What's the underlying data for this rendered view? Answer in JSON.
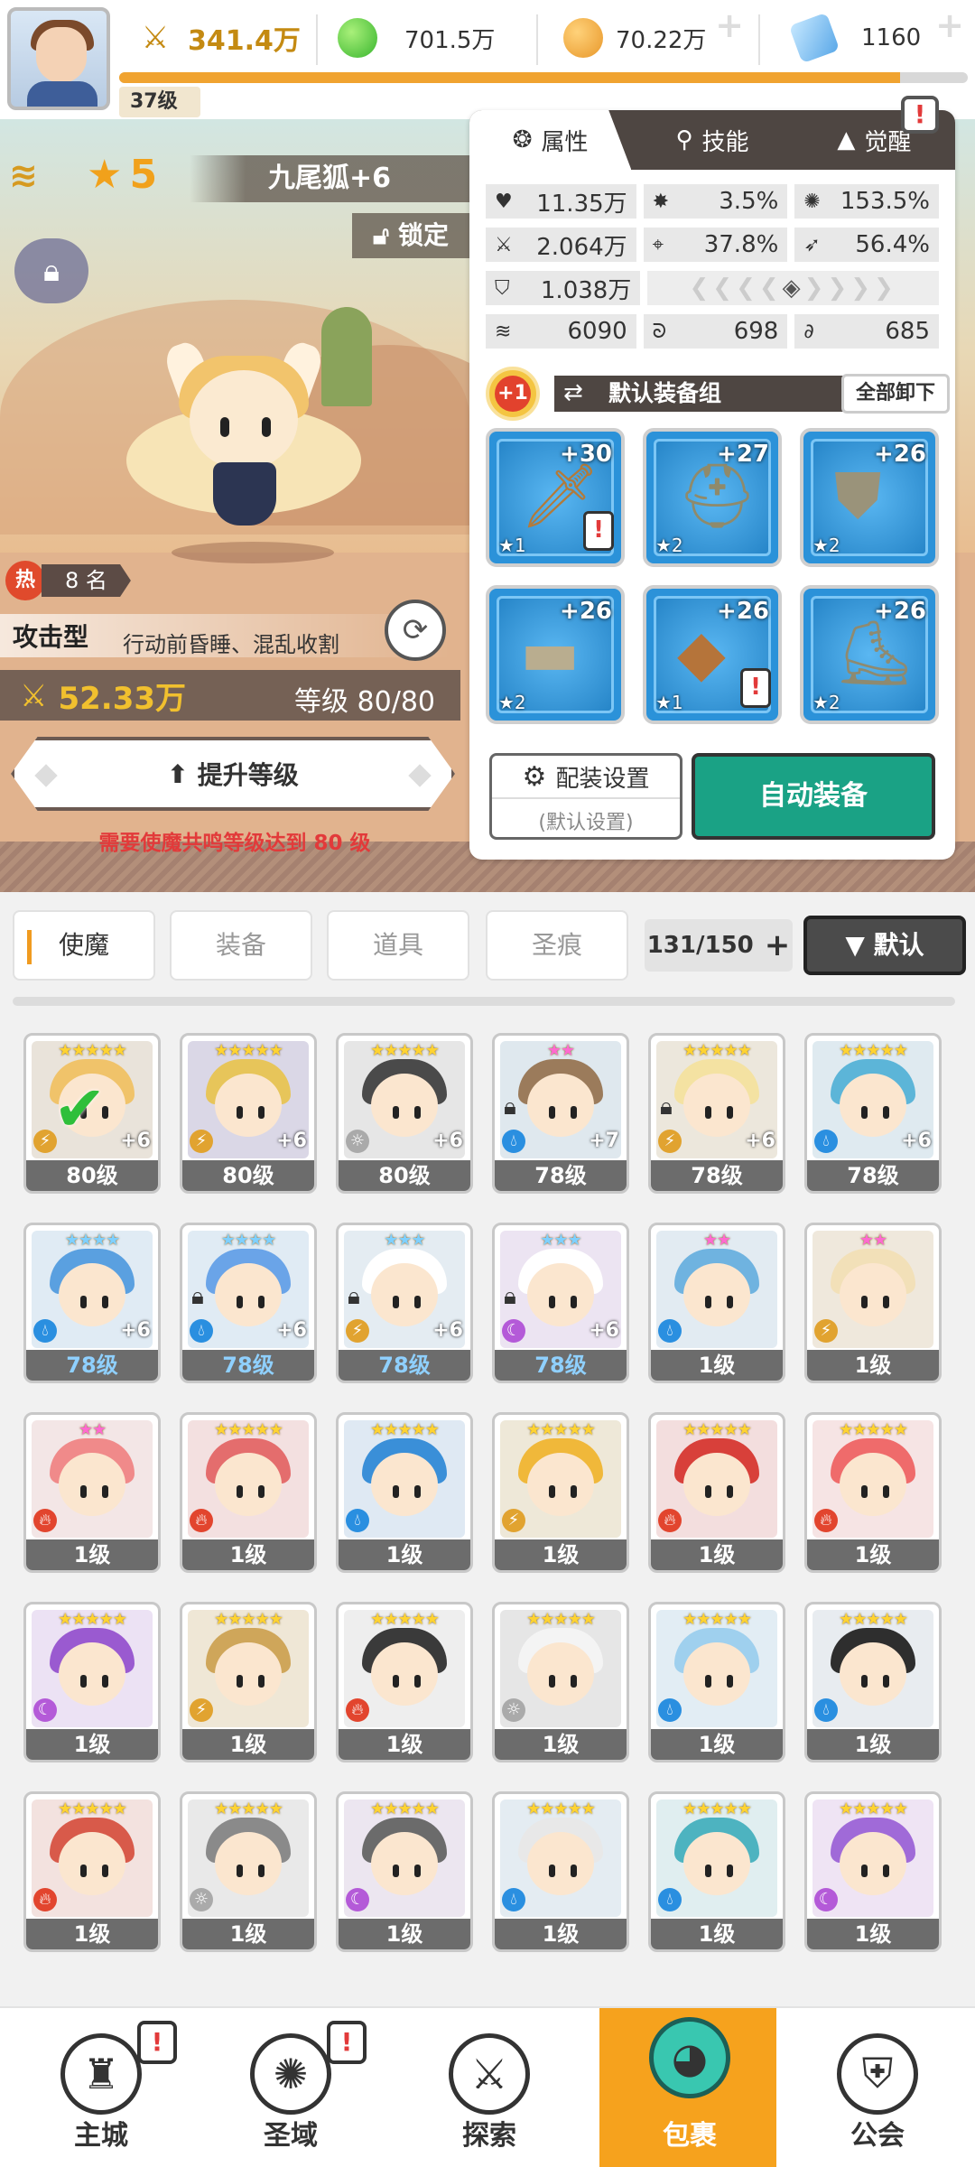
{
  "top": {
    "player_level": "37级",
    "xp_progress": 0.92,
    "power": "341.4万",
    "green_currency": "701.5万",
    "gold_currency": "70.22万",
    "gem_currency": "1160"
  },
  "hero": {
    "stars": "5",
    "name": "九尾狐+6",
    "lock_label": "锁定",
    "hot_label": "热",
    "rank_label": "8 名",
    "type": "攻击型",
    "type_desc": "行动前昏睡、混乱收割",
    "power": "52.33万",
    "level": "等级 80/80",
    "upgrade_label": "提升等级",
    "requirement": "需要使魔共鸣等级达到 80 级"
  },
  "panel": {
    "tabs": [
      {
        "label": "属性",
        "icon": "attributes-icon"
      },
      {
        "label": "技能",
        "icon": "skills-icon"
      },
      {
        "label": "觉醒",
        "icon": "awaken-icon"
      }
    ],
    "stats": {
      "hp": "11.35万",
      "crit_rate": "3.5%",
      "crit_dmg": "153.5%",
      "attack": "2.064万",
      "accuracy": "37.8%",
      "dodge": "56.4%",
      "defense": "1.038万",
      "speed": "6090",
      "effect_hit": "698",
      "effect_res": "685"
    },
    "medal": "+1",
    "equip_set": "默认装备组",
    "unequip_all": "全部卸下",
    "equipment": [
      {
        "name": "sword",
        "plus": "+30",
        "stars": "★1",
        "warn": true
      },
      {
        "name": "helmet",
        "plus": "+27",
        "stars": "★2",
        "warn": false
      },
      {
        "name": "armor",
        "plus": "+26",
        "stars": "★2",
        "warn": false
      },
      {
        "name": "belt",
        "plus": "+26",
        "stars": "★2",
        "warn": false
      },
      {
        "name": "necklace",
        "plus": "+26",
        "stars": "★1",
        "warn": true
      },
      {
        "name": "boots",
        "plus": "+26",
        "stars": "★2",
        "warn": false
      }
    ],
    "config_label": "配装设置",
    "config_sub": "(默认设置)",
    "auto_equip": "自动装备",
    "warn_mark": "!"
  },
  "inventory": {
    "tabs": [
      "使魔",
      "装备",
      "道具",
      "圣痕"
    ],
    "count": "131/150",
    "sort": "▼ 默认",
    "heroes": [
      {
        "lvl": "80级",
        "stars": "★★★★★",
        "plus": "+6",
        "hair": "#f0c36a",
        "bg": "#e9e3da",
        "elem": "earth",
        "check": true
      },
      {
        "lvl": "80级",
        "stars": "★★★★★",
        "plus": "+6",
        "hair": "#e7c55a",
        "bg": "#dad7e6",
        "elem": "earth"
      },
      {
        "lvl": "80级",
        "stars": "★★★★★",
        "plus": "+6",
        "hair": "#4a4a4a",
        "bg": "#e6e6e6",
        "elem": "light"
      },
      {
        "lvl": "78级",
        "stars": "★★",
        "plus": "+7",
        "hair": "#9b7b5b",
        "bg": "#dfe8ee",
        "elem": "water",
        "lock": true
      },
      {
        "lvl": "78级",
        "stars": "★★★★★",
        "plus": "+6",
        "hair": "#f4e2a2",
        "bg": "#ece7dc",
        "elem": "earth",
        "lock": true
      },
      {
        "lvl": "78级",
        "stars": "★★★★★",
        "plus": "+6",
        "hair": "#5cb5d8",
        "bg": "#dfeaf0",
        "elem": "water"
      },
      {
        "lvl": "78级",
        "stars": "★★★★",
        "plus": "+6",
        "hair": "#5aa0e0",
        "bg": "#e0ebf4",
        "elem": "water",
        "blue": true
      },
      {
        "lvl": "78级",
        "stars": "★★★★",
        "plus": "+6",
        "hair": "#6aa4e8",
        "bg": "#e0ebf4",
        "elem": "water",
        "lock": true,
        "blue": true
      },
      {
        "lvl": "78级",
        "stars": "★★★",
        "plus": "+6",
        "hair": "#ffffff",
        "bg": "#e4ecf2",
        "elem": "earth",
        "lock": true,
        "blue": true
      },
      {
        "lvl": "78级",
        "stars": "★★★",
        "plus": "+6",
        "hair": "#ffffff",
        "bg": "#ece4f2",
        "elem": "dark",
        "lock": true,
        "blue": true
      },
      {
        "lvl": "1级",
        "stars": "★★",
        "hair": "#6fb3e0",
        "bg": "#e2ebf2",
        "elem": "water"
      },
      {
        "lvl": "1级",
        "stars": "★★",
        "hair": "#f2e0b8",
        "bg": "#efe8dc",
        "elem": "earth"
      },
      {
        "lvl": "1级",
        "stars": "★★",
        "hair": "#f08a8a",
        "bg": "#f3e6e6",
        "elem": "fire"
      },
      {
        "lvl": "1级",
        "stars": "★★★★★",
        "hair": "#e46d6d",
        "bg": "#f3e0e0",
        "elem": "fire"
      },
      {
        "lvl": "1级",
        "stars": "★★★★★",
        "hair": "#3a8fd8",
        "bg": "#dfe9f3",
        "elem": "water"
      },
      {
        "lvl": "1级",
        "stars": "★★★★★",
        "hair": "#f0b83a",
        "bg": "#eee8d8",
        "elem": "earth"
      },
      {
        "lvl": "1级",
        "stars": "★★★★★",
        "hair": "#d8403a",
        "bg": "#f3dede",
        "elem": "fire"
      },
      {
        "lvl": "1级",
        "stars": "★★★★★",
        "hair": "#ef6b6b",
        "bg": "#f6e4e4",
        "elem": "fire"
      },
      {
        "lvl": "1级",
        "stars": "★★★★★",
        "hair": "#9a5ad0",
        "bg": "#ece2f4",
        "elem": "dark"
      },
      {
        "lvl": "1级",
        "stars": "★★★★★",
        "hair": "#cfa65a",
        "bg": "#efe7d6",
        "elem": "earth"
      },
      {
        "lvl": "1级",
        "stars": "★★★★★",
        "hair": "#3a3a3a",
        "bg": "#eeeeee",
        "elem": "fire"
      },
      {
        "lvl": "1级",
        "stars": "★★★★★",
        "hair": "#f4f4f4",
        "bg": "#e6e6e6",
        "elem": "light"
      },
      {
        "lvl": "1级",
        "stars": "★★★★★",
        "hair": "#9fd0ee",
        "bg": "#e2edf4",
        "elem": "water"
      },
      {
        "lvl": "1级",
        "stars": "★★★★★",
        "hair": "#2e2e2e",
        "bg": "#e8ecf0",
        "elem": "water"
      },
      {
        "lvl": "1级",
        "stars": "★★★★★",
        "hair": "#d85a4a",
        "bg": "#f3e2df",
        "elem": "fire"
      },
      {
        "lvl": "1级",
        "stars": "★★★★★",
        "hair": "#8a8a8a",
        "bg": "#e9e9e9",
        "elem": "light"
      },
      {
        "lvl": "1级",
        "stars": "★★★★★",
        "hair": "#6b6b6b",
        "bg": "#ece6f0",
        "elem": "dark"
      },
      {
        "lvl": "1级",
        "stars": "★★★★★",
        "hair": "#e8e8e8",
        "bg": "#e4ecf2",
        "elem": "water"
      },
      {
        "lvl": "1级",
        "stars": "★★★★★",
        "hair": "#4db3c0",
        "bg": "#e0eef0",
        "elem": "water"
      },
      {
        "lvl": "1级",
        "stars": "★★★★★",
        "hair": "#a06ad8",
        "bg": "#efe4f4",
        "elem": "dark"
      }
    ]
  },
  "nav": [
    {
      "label": "主城",
      "icon": "castle-icon",
      "badge": true
    },
    {
      "label": "圣域",
      "icon": "portal-icon",
      "badge": true
    },
    {
      "label": "探索",
      "icon": "sword-explore-icon"
    },
    {
      "label": "包裹",
      "icon": "bag-icon",
      "active": true
    },
    {
      "label": "公会",
      "icon": "guild-icon"
    }
  ],
  "colors": {
    "accent_orange": "#f6a21d",
    "auto_green": "#1aa285",
    "requirement_red": "#e23a3a",
    "power_gold": "#f1c02e"
  }
}
